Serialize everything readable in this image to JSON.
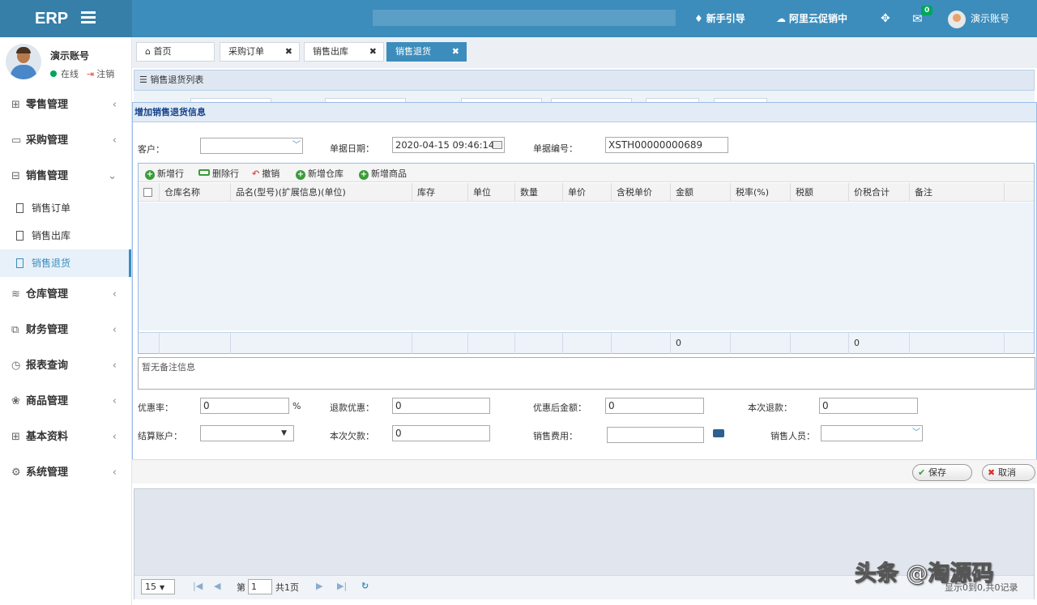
{
  "header": {
    "logo": "ERP",
    "guide": "新手引导",
    "promo": "阿里云促销中",
    "mail_badge": "0",
    "account": "演示账号"
  },
  "user": {
    "name": "演示账号",
    "status": "在线",
    "logout": "注销"
  },
  "menu": {
    "retail": "零售管理",
    "purchase": "采购管理",
    "sales": "销售管理",
    "sales_sub": [
      "销售订单",
      "销售出库",
      "销售退货"
    ],
    "warehouse": "仓库管理",
    "finance": "财务管理",
    "reports": "报表查询",
    "goods": "商品管理",
    "basic": "基本资料",
    "system": "系统管理"
  },
  "tabs": [
    "首页",
    "采购订单",
    "销售出库",
    "销售退货"
  ],
  "list_title": "销售退货列表",
  "dialog": {
    "title": "增加销售退货信息",
    "customer_label": "客户：",
    "customer_value": "",
    "date_label": "单据日期：",
    "date_value": "2020-04-15 09:46:14",
    "number_label": "单据编号：",
    "number_value": "XSTH00000000689",
    "toolbar": [
      "新增行",
      "删除行",
      "撤销",
      "新增仓库",
      "新增商品"
    ],
    "columns": [
      "仓库名称",
      "品名(型号)(扩展信息)(单位)",
      "库存",
      "单位",
      "数量",
      "单价",
      "含税单价",
      "金额",
      "税率(%)",
      "税额",
      "价税合计",
      "备注"
    ],
    "footer_amount": "0",
    "footer_total": "0",
    "remark": "暂无备注信息",
    "discount_rate_label": "优惠率：",
    "discount_rate_value": "0",
    "percent": "%",
    "refund_discount_label": "退款优惠：",
    "refund_discount_value": "0",
    "after_discount_label": "优惠后金额：",
    "after_discount_value": "0",
    "refund_label": "本次退款：",
    "refund_value": "0",
    "account_label": "结算账户：",
    "debt_label": "本次欠款：",
    "debt_value": "0",
    "cost_label": "销售费用：",
    "cost_value": "",
    "salesman_label": "销售人员：",
    "save": "保存",
    "cancel": "取消"
  },
  "pager": {
    "size": "15",
    "page_prefix": "第",
    "page": "1",
    "total": "共1页",
    "summary": "显示0到0,共0记录"
  },
  "watermark": "头条 @淘源码"
}
